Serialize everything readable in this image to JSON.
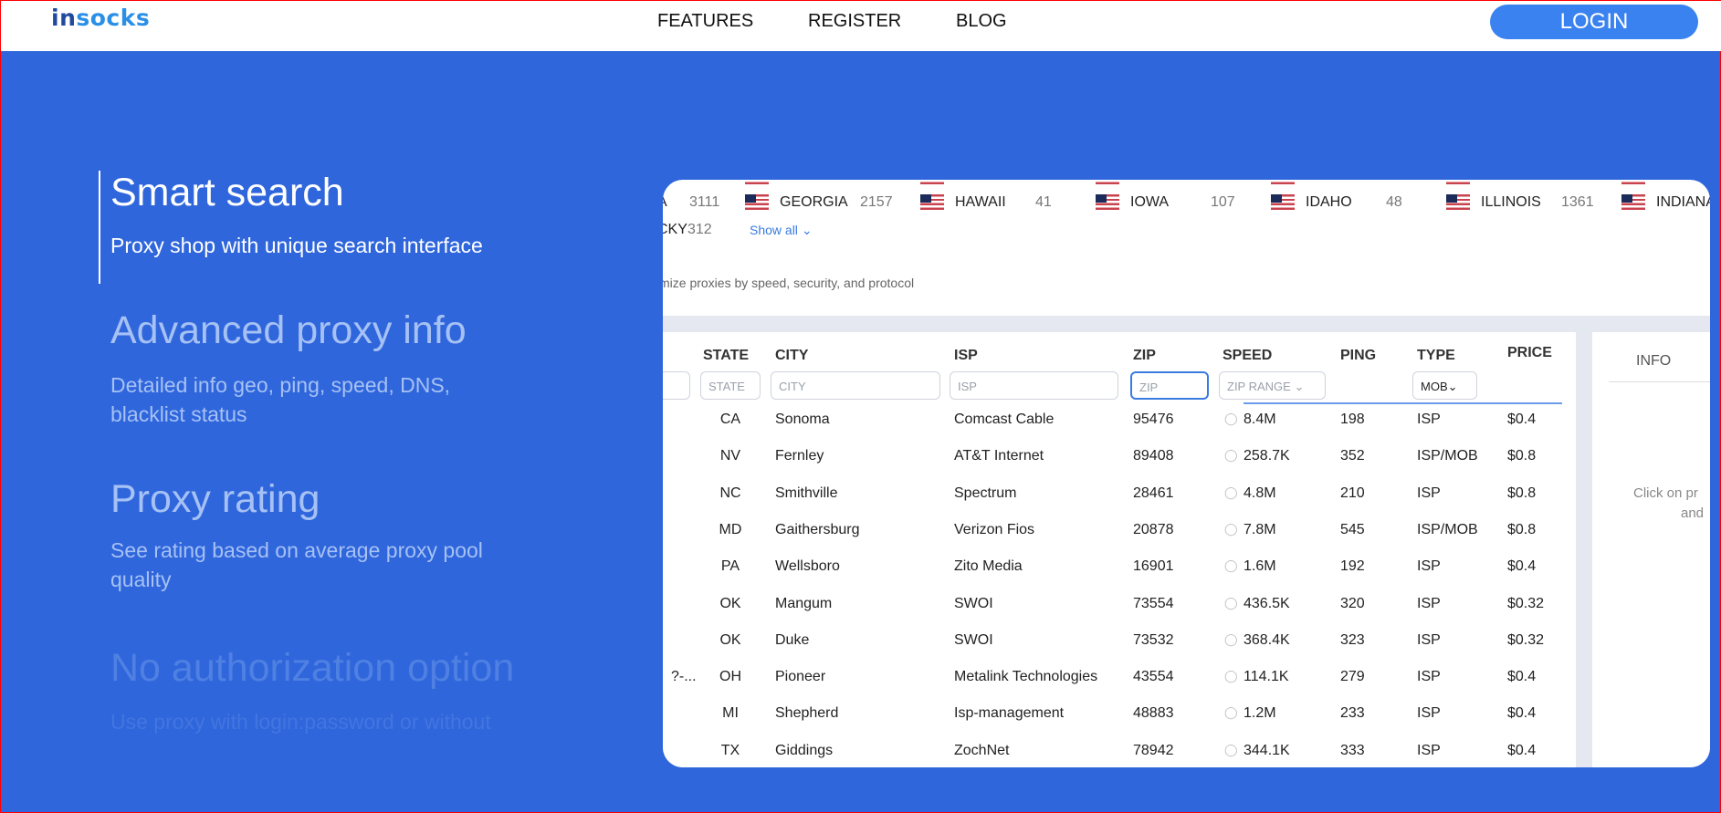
{
  "header": {
    "logo_a": "in",
    "logo_b": "socks",
    "nav": [
      "FEATURES",
      "REGISTER",
      "BLOG"
    ],
    "login": "LOGIN"
  },
  "features": [
    {
      "title": "Smart search",
      "desc": "Proxy shop with unique search interface"
    },
    {
      "title": "Advanced proxy info",
      "desc": "Detailed info geo, ping, speed, DNS, blacklist status"
    },
    {
      "title": "Proxy rating",
      "desc": "See rating based on average proxy pool quality"
    },
    {
      "title": "No authorization option",
      "desc": "Use proxy with login:password or without"
    }
  ],
  "states": {
    "first_partial": {
      "name": "A",
      "count": "3111"
    },
    "items": [
      {
        "name": "GEORGIA",
        "count": "2157"
      },
      {
        "name": "HAWAII",
        "count": "41"
      },
      {
        "name": "IOWA",
        "count": "107"
      },
      {
        "name": "IDAHO",
        "count": "48"
      },
      {
        "name": "ILLINOIS",
        "count": "1361"
      },
      {
        "name": "INDIANA",
        "count": ""
      }
    ],
    "second_row_partial": {
      "name": "CKY",
      "count": "312"
    },
    "show_all": "Show all"
  },
  "description": "mize proxies by speed, security, and protocol",
  "table": {
    "headers": {
      "state": "STATE",
      "city": "CITY",
      "isp": "ISP",
      "zip": "ZIP",
      "speed": "SPEED",
      "ping": "PING",
      "type": "TYPE",
      "price": "PRICE"
    },
    "filters": {
      "state": "STATE",
      "city": "CITY",
      "isp": "ISP",
      "zip": "ZIP",
      "speed": "ZIP RANGE",
      "type": "MOB"
    },
    "rows": [
      {
        "prefix": "",
        "state": "CA",
        "city": "Sonoma",
        "isp": "Comcast Cable",
        "zip": "95476",
        "speed": "8.4M",
        "ping": "198",
        "type": "ISP",
        "price": "$0.4"
      },
      {
        "prefix": "",
        "state": "NV",
        "city": "Fernley",
        "isp": "AT&T Internet",
        "zip": "89408",
        "speed": "258.7K",
        "ping": "352",
        "type": "ISP/MOB",
        "price": "$0.8"
      },
      {
        "prefix": "",
        "state": "NC",
        "city": "Smithville",
        "isp": "Spectrum",
        "zip": "28461",
        "speed": "4.8M",
        "ping": "210",
        "type": "ISP",
        "price": "$0.8"
      },
      {
        "prefix": "",
        "state": "MD",
        "city": "Gaithersburg",
        "isp": "Verizon Fios",
        "zip": "20878",
        "speed": "7.8M",
        "ping": "545",
        "type": "ISP/MOB",
        "price": "$0.8"
      },
      {
        "prefix": "",
        "state": "PA",
        "city": "Wellsboro",
        "isp": "Zito Media",
        "zip": "16901",
        "speed": "1.6M",
        "ping": "192",
        "type": "ISP",
        "price": "$0.4"
      },
      {
        "prefix": "",
        "state": "OK",
        "city": "Mangum",
        "isp": "SWOI",
        "zip": "73554",
        "speed": "436.5K",
        "ping": "320",
        "type": "ISP",
        "price": "$0.32"
      },
      {
        "prefix": "",
        "state": "OK",
        "city": "Duke",
        "isp": "SWOI",
        "zip": "73532",
        "speed": "368.4K",
        "ping": "323",
        "type": "ISP",
        "price": "$0.32"
      },
      {
        "prefix": "?-...",
        "state": "OH",
        "city": "Pioneer",
        "isp": "Metalink Technologies",
        "zip": "43554",
        "speed": "114.1K",
        "ping": "279",
        "type": "ISP",
        "price": "$0.4"
      },
      {
        "prefix": "",
        "state": "MI",
        "city": "Shepherd",
        "isp": "Isp-management",
        "zip": "48883",
        "speed": "1.2M",
        "ping": "233",
        "type": "ISP",
        "price": "$0.4"
      },
      {
        "prefix": "",
        "state": "TX",
        "city": "Giddings",
        "isp": "ZochNet",
        "zip": "78942",
        "speed": "344.1K",
        "ping": "333",
        "type": "ISP",
        "price": "$0.4"
      }
    ]
  },
  "info": {
    "title": "INFO",
    "hint_1": "Click on pr",
    "hint_2": "and"
  },
  "colors": {
    "background": "#2f66dc",
    "accent": "#3a82f0"
  }
}
